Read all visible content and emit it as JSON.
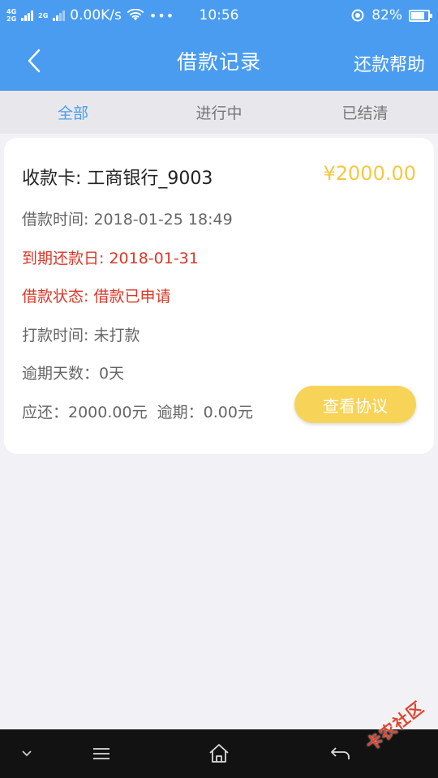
{
  "status_bar": {
    "net_top": "4G",
    "net_bottom": "2G",
    "net_mid": "2G",
    "speed": "0.00K/s",
    "dots": "•••",
    "time": "10:56",
    "battery": "82%",
    "battery_level": 0.82
  },
  "nav": {
    "title": "借款记录",
    "help": "还款帮助"
  },
  "tabs": [
    {
      "label": "全部",
      "active": true
    },
    {
      "label": "进行中",
      "active": false
    },
    {
      "label": "已结清",
      "active": false
    }
  ],
  "card": {
    "receiving_card": "收款卡: 工商银行_9003",
    "amount": "¥2000.00",
    "loan_time": "借款时间: 2018-01-25 18:49",
    "due_date": "到期还款日: 2018-01-31",
    "loan_status": "借款状态: 借款已申请",
    "payout_time": "打款时间: 未打款",
    "overdue_days": "逾期天数：0天",
    "summary": "应还：2000.00元  逾期：0.00元",
    "agreement_button": "查看协议"
  },
  "watermark": "卡农社区",
  "colors": {
    "primary": "#4a9cf0",
    "amount": "#f5c842",
    "alert": "#d8382a",
    "button": "#f7d458"
  }
}
